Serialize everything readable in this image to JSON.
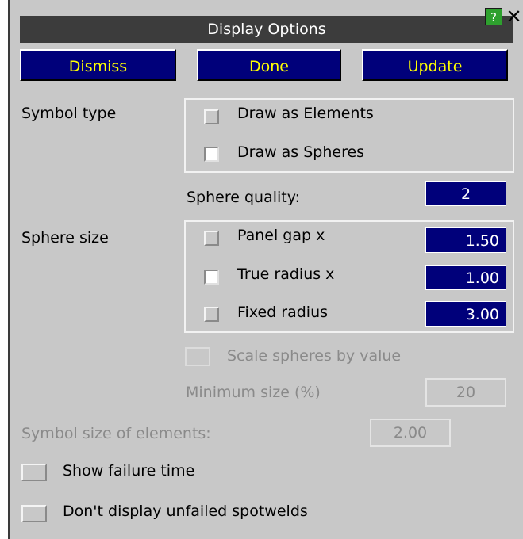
{
  "window": {
    "title": "Display Options",
    "help_glyph": "?",
    "close_glyph": "✕"
  },
  "buttons": {
    "dismiss": "Dismiss",
    "done": "Done",
    "update": "Update"
  },
  "symbol_type": {
    "label": "Symbol type",
    "options": [
      {
        "label": "Draw as Elements",
        "checked": false
      },
      {
        "label": "Draw as Spheres",
        "checked": true
      }
    ]
  },
  "sphere_quality": {
    "label": "Sphere quality:",
    "value": "2"
  },
  "sphere_size": {
    "label": "Sphere size",
    "options": [
      {
        "label": "Panel gap x",
        "value": "1.50",
        "checked": false
      },
      {
        "label": "True radius x",
        "value": "1.00",
        "checked": true
      },
      {
        "label": "Fixed radius",
        "value": "3.00",
        "checked": false
      }
    ]
  },
  "scale_spheres": {
    "label": "Scale spheres by value",
    "enabled": false
  },
  "minimum_size": {
    "label": "Minimum size (%)",
    "value": "20"
  },
  "symbol_size": {
    "label": "Symbol size of elements:",
    "value": "2.00"
  },
  "show_failure_time": {
    "label": "Show failure time",
    "checked": false
  },
  "dont_display_unfailed": {
    "label": "Don't display unfailed spotwelds",
    "checked": false
  },
  "colors": {
    "button_bg": "#00007a",
    "button_text": "#ffff00",
    "titlebar_bg": "#3c3c3c",
    "panel_bg": "#c8c8c8"
  }
}
